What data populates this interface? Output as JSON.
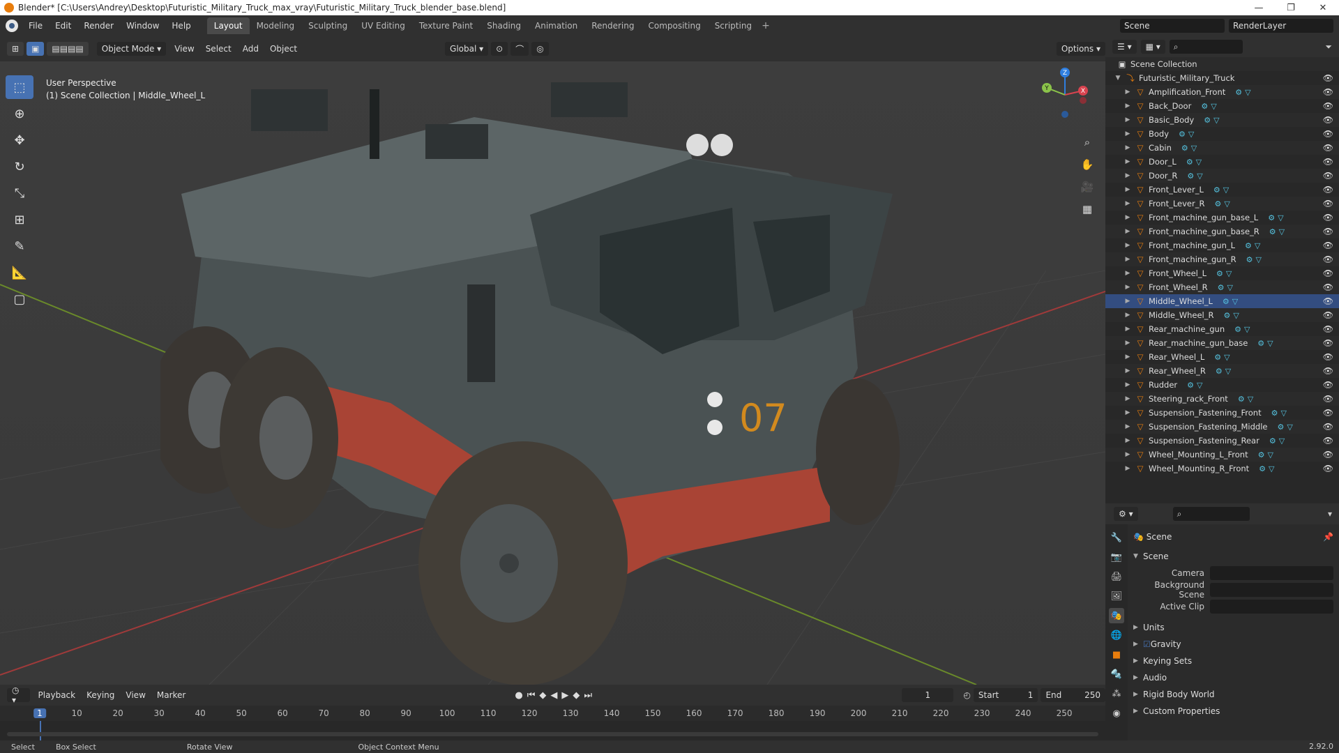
{
  "window": {
    "title": "Blender* [C:\\Users\\Andrey\\Desktop\\Futuristic_Military_Truck_max_vray\\Futuristic_Military_Truck_blender_base.blend]",
    "controls": [
      "—",
      "❐",
      "✕"
    ]
  },
  "menu": [
    "File",
    "Edit",
    "Render",
    "Window",
    "Help"
  ],
  "workspaces": [
    "Layout",
    "Modeling",
    "Sculpting",
    "UV Editing",
    "Texture Paint",
    "Shading",
    "Animation",
    "Rendering",
    "Compositing",
    "Scripting"
  ],
  "scene_field": "Scene",
  "renderlayer_field": "RenderLayer",
  "viewport": {
    "mode": "Object Mode",
    "menus": [
      "View",
      "Select",
      "Add",
      "Object"
    ],
    "transform": "Global",
    "options": "Options",
    "perspective": "User Perspective",
    "collection_info": "(1) Scene Collection | Middle_Wheel_L",
    "truck_number": "07"
  },
  "gizmo": {
    "z": "Z",
    "y": "Y",
    "x": "X"
  },
  "timeline": {
    "menus": [
      "Playback",
      "Keying",
      "View",
      "Marker"
    ],
    "current_frame": "1",
    "start_label": "Start",
    "start": "1",
    "end_label": "End",
    "end": "250",
    "ticks": [
      "10",
      "20",
      "30",
      "40",
      "50",
      "60",
      "70",
      "80",
      "90",
      "100",
      "110",
      "120",
      "130",
      "140",
      "150",
      "160",
      "170",
      "180",
      "190",
      "200",
      "210",
      "220",
      "230",
      "240",
      "250"
    ]
  },
  "status": [
    "Select",
    "Box Select",
    "Rotate View",
    "Object Context Menu"
  ],
  "version": "2.92.0",
  "outliner": {
    "root": "Scene Collection",
    "collection": "Futuristic_Military_Truck",
    "selected": "Middle_Wheel_L",
    "items": [
      "Amplification_Front",
      "Back_Door",
      "Basic_Body",
      "Body",
      "Cabin",
      "Door_L",
      "Door_R",
      "Front_Lever_L",
      "Front_Lever_R",
      "Front_machine_gun_base_L",
      "Front_machine_gun_base_R",
      "Front_machine_gun_L",
      "Front_machine_gun_R",
      "Front_Wheel_L",
      "Front_Wheel_R",
      "Middle_Wheel_L",
      "Middle_Wheel_R",
      "Rear_machine_gun",
      "Rear_machine_gun_base",
      "Rear_Wheel_L",
      "Rear_Wheel_R",
      "Rudder",
      "Steering_rack_Front",
      "Suspension_Fastening_Front",
      "Suspension_Fastening_Middle",
      "Suspension_Fastening_Rear",
      "Wheel_Mounting_L_Front",
      "Wheel_Mounting_R_Front"
    ]
  },
  "properties": {
    "context": "Scene",
    "panel": "Scene",
    "fields": [
      {
        "label": "Camera"
      },
      {
        "label": "Background Scene"
      },
      {
        "label": "Active Clip"
      }
    ],
    "sections": [
      "Units",
      "Gravity",
      "Keying Sets",
      "Audio",
      "Rigid Body World",
      "Custom Properties"
    ]
  },
  "colors": {
    "accent": "#4772b3",
    "orange": "#e87d0d"
  }
}
